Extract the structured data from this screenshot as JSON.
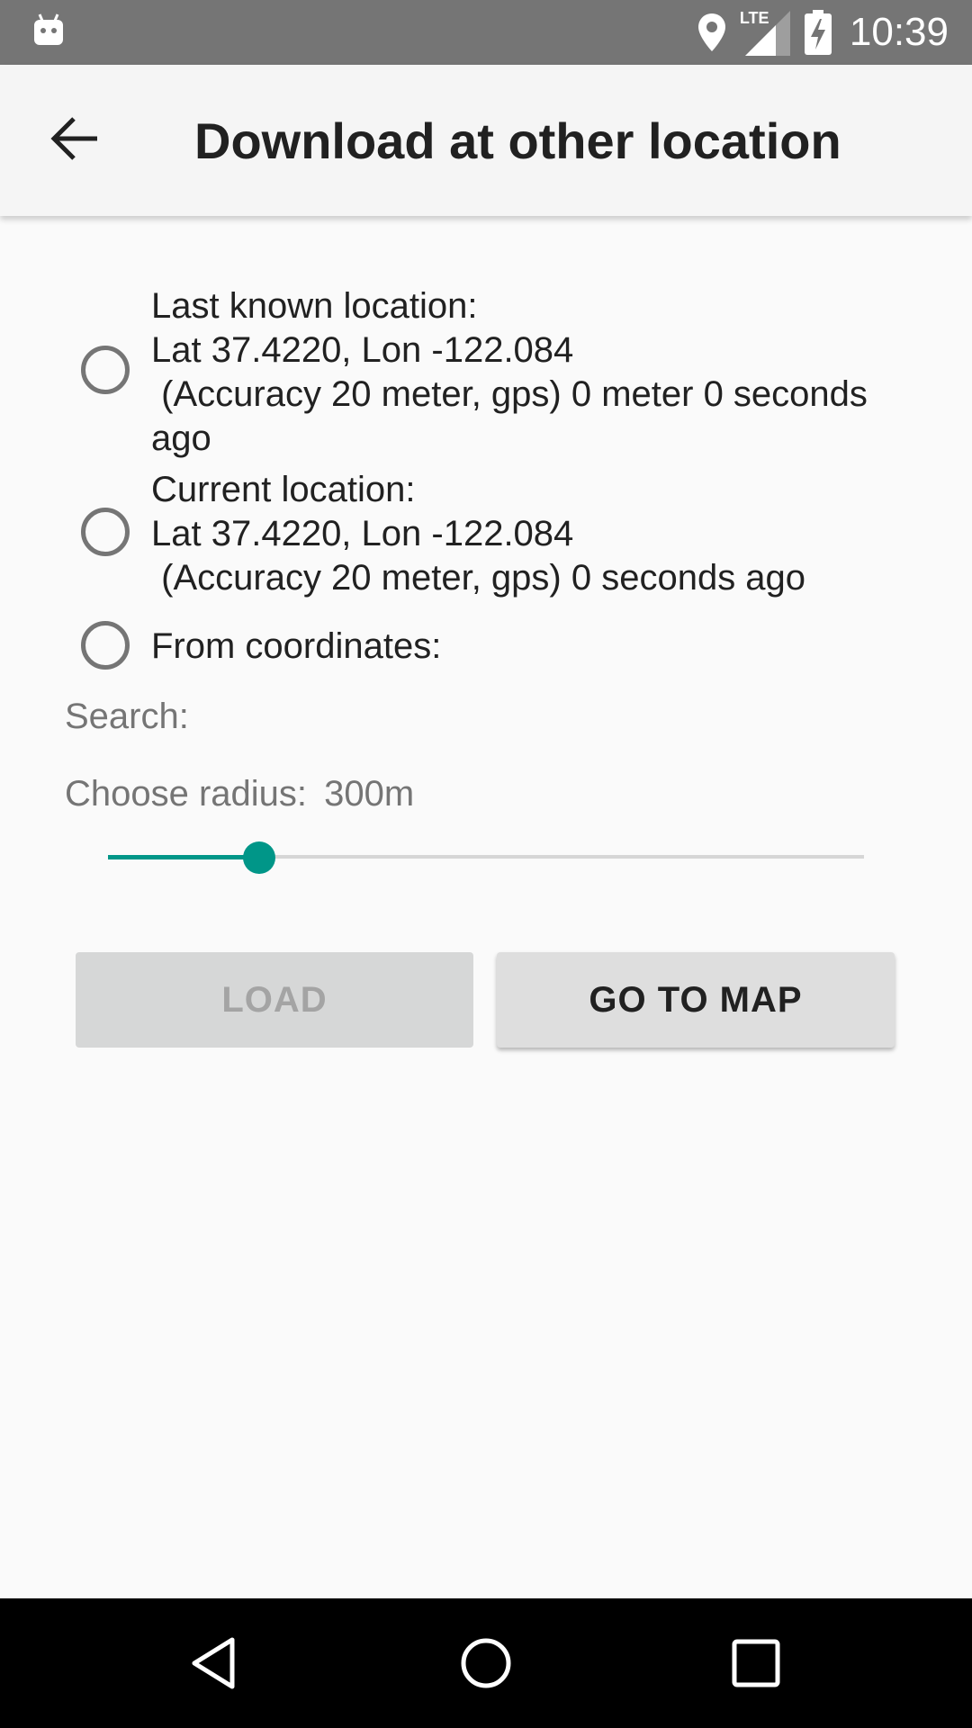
{
  "status_bar": {
    "time": "10:39",
    "network_label": "LTE",
    "icons": [
      "android-icon",
      "location-icon",
      "lte-signal-icon",
      "battery-charging-icon"
    ]
  },
  "app_bar": {
    "title": "Download at other location",
    "back_icon": "arrow-back-icon"
  },
  "options": [
    {
      "text": "Last known location:\nLat 37.4220, Lon -122.084\n (Accuracy 20 meter, gps) 0 meter 0 seconds\nago",
      "checked": false
    },
    {
      "text": "Current location:\nLat 37.4220, Lon -122.084\n (Accuracy 20 meter, gps) 0 seconds ago",
      "checked": false
    },
    {
      "text": "From coordinates:",
      "checked": false
    }
  ],
  "search_label": "Search:",
  "radius": {
    "label": "Choose radius:",
    "value": "300m",
    "slider_fraction": 0.2
  },
  "buttons": {
    "load": "LOAD",
    "go_to_map": "GO TO MAP"
  },
  "nav_bar": {
    "icons": [
      "back-triangle-icon",
      "home-circle-icon",
      "recents-square-icon"
    ]
  },
  "colors": {
    "accent": "#009688",
    "status_bar": "#757575",
    "app_bar": "#f5f5f5"
  }
}
